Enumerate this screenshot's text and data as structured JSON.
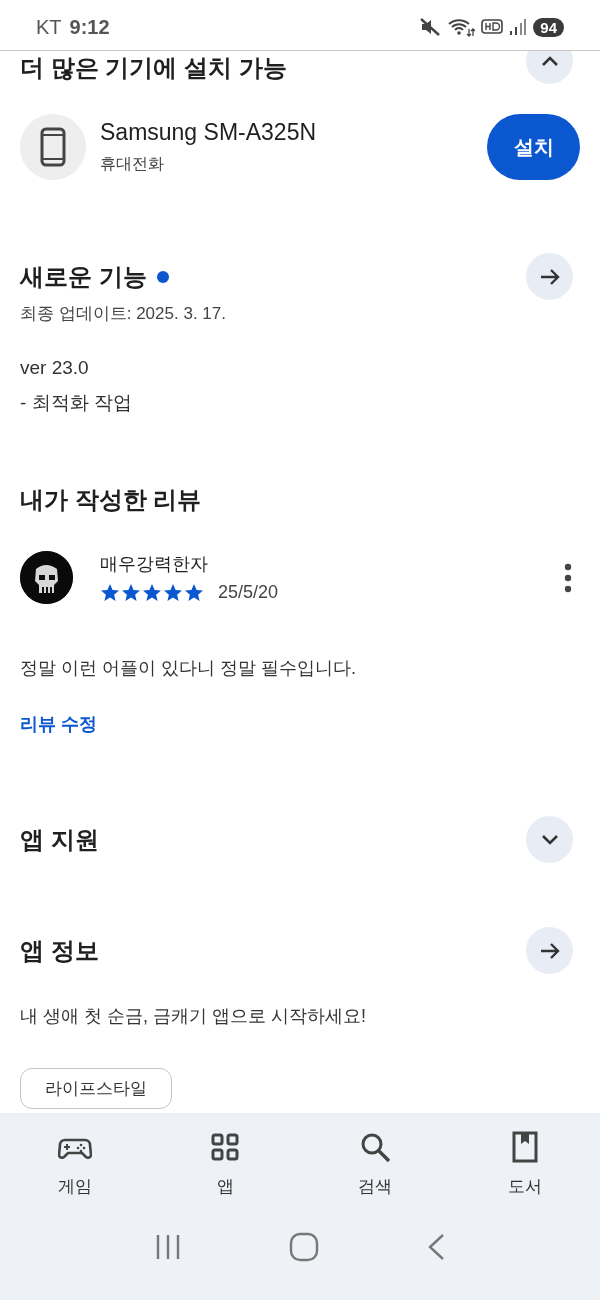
{
  "status_bar": {
    "carrier": "KT",
    "time": "9:12",
    "battery": "94"
  },
  "install_section": {
    "title": "더 많은 기기에 설치 가능",
    "kind": "collapse",
    "device": {
      "name": "Samsung SM-A325N",
      "type": "휴대전화",
      "button": "설치"
    }
  },
  "whats_new": {
    "title": "새로운 기능",
    "new_dot": true,
    "kind": "arrow",
    "updated": "최종 업데이트: 2025. 3. 17.",
    "notes": [
      "ver 23.0",
      "- 최적화 작업"
    ]
  },
  "my_review": {
    "title": "내가 작성한 리뷰",
    "author": "매우강력한자",
    "stars": 5,
    "date": "25/5/20",
    "text": "정말 이런 어플이 있다니 정말 필수입니다.",
    "edit_link": "리뷰 수정"
  },
  "app_support": {
    "title": "앱 지원",
    "kind": "expand"
  },
  "app_info": {
    "title": "앱 정보",
    "kind": "arrow",
    "description": "내 생애 첫 순금, 금캐기 앱으로 시작하세요!",
    "tags": [
      "라이프스타일"
    ]
  },
  "bottom_nav": [
    {
      "label": "게임",
      "selected": false
    },
    {
      "label": "앱",
      "selected": false
    },
    {
      "label": "검색",
      "selected": false
    },
    {
      "label": "도서",
      "selected": false
    }
  ]
}
